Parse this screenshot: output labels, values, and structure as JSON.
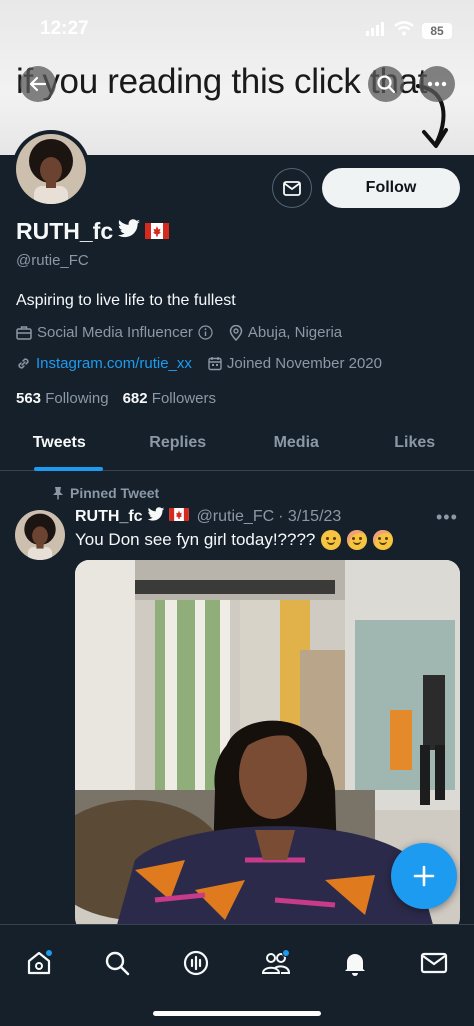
{
  "status_bar": {
    "time": "12:27",
    "battery": "85",
    "icons": [
      "signal-icon",
      "wifi-icon",
      "battery-icon"
    ]
  },
  "banner": {
    "caption": "if you reading this click that"
  },
  "header": {
    "back_icon": "arrow-left-icon",
    "search_icon": "search-icon",
    "more_icon": "more-horizontal-icon"
  },
  "profile": {
    "name": "RUTH_fc",
    "name_badges": [
      "twitter-bird-icon",
      "canada-flag-icon"
    ],
    "handle": "@rutie_FC",
    "follow_label": "Follow",
    "message_icon": "mail-icon",
    "bio": "Aspiring to live life to the fullest",
    "category": "Social Media Influencer",
    "location": "Abuja, Nigeria",
    "website": "Instagram.com/rutie_xx",
    "joined": "Joined November 2020",
    "following_count": "563",
    "following_label": "Following",
    "followers_count": "682",
    "followers_label": "Followers"
  },
  "tabs": [
    {
      "label": "Tweets",
      "active": true
    },
    {
      "label": "Replies",
      "active": false
    },
    {
      "label": "Media",
      "active": false
    },
    {
      "label": "Likes",
      "active": false
    }
  ],
  "tweet": {
    "pinned_label": "Pinned Tweet",
    "author_name": "RUTH_fc",
    "author_handle": "@rutie_FC",
    "date": "· 3/15/23",
    "text": "You Don see fyn girl today!????",
    "emojis": [
      "slightly-smiling-face",
      "smiling-face",
      "smiling-face"
    ]
  },
  "fab": {
    "icon": "plus-icon"
  },
  "bottom_nav": [
    {
      "name": "home",
      "icon": "home-icon",
      "badge": true
    },
    {
      "name": "search",
      "icon": "search-icon",
      "badge": false
    },
    {
      "name": "spaces",
      "icon": "spaces-icon",
      "badge": false
    },
    {
      "name": "communities",
      "icon": "communities-icon",
      "badge": true
    },
    {
      "name": "notifications",
      "icon": "bell-icon",
      "badge": false
    },
    {
      "name": "messages",
      "icon": "mail-icon",
      "badge": false
    }
  ],
  "colors": {
    "background": "#15202b",
    "accent": "#1d9bf0",
    "secondary_text": "#8b98a5",
    "divider": "#38444d"
  }
}
